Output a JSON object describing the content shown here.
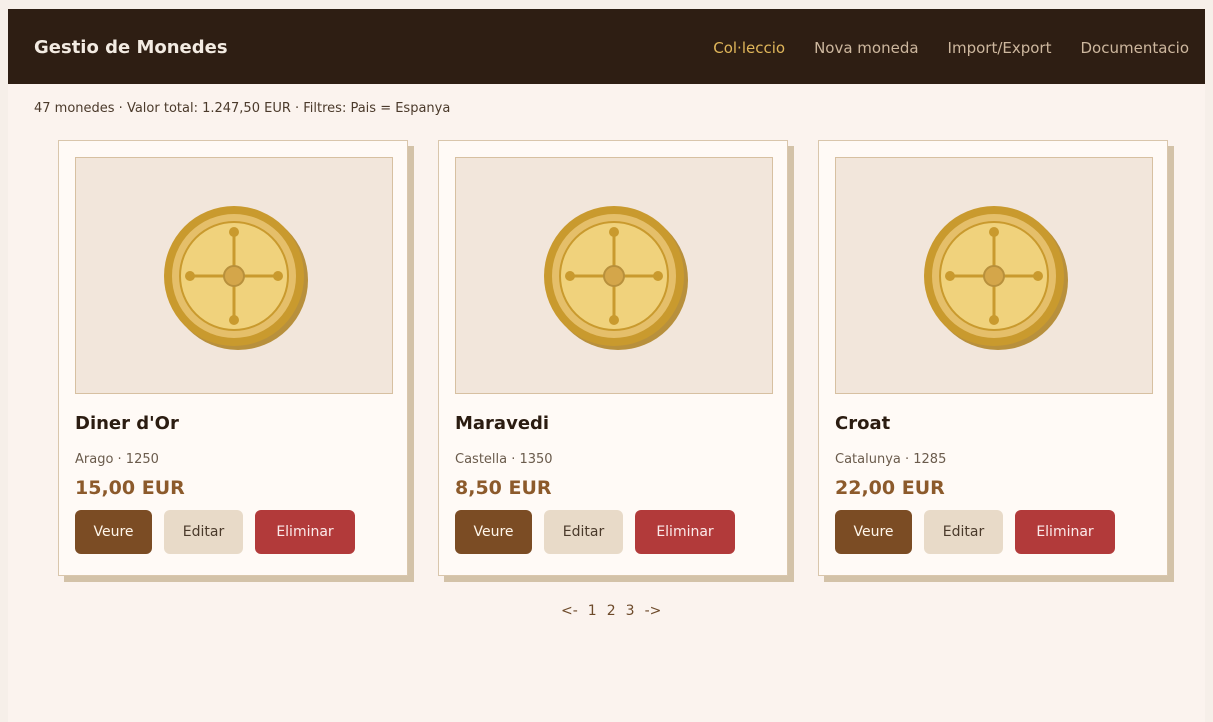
{
  "app": {
    "title": "Gestio de Monedes",
    "nav": [
      {
        "label": "Col·leccio",
        "active": true
      },
      {
        "label": "Nova moneda",
        "active": false
      },
      {
        "label": "Import/Export",
        "active": false
      },
      {
        "label": "Documentacio",
        "active": false
      }
    ]
  },
  "summary": "47 monedes · Valor total: 1.247,50 EUR  ·  Filtres: Pais = Espanya",
  "coins": [
    {
      "name": "Diner d'Or",
      "meta": "Arago · 1250",
      "price": "15,00 EUR",
      "icon": "coin-image"
    },
    {
      "name": "Maravedi",
      "meta": "Castella · 1350",
      "price": "8,50 EUR",
      "icon": "coin-image"
    },
    {
      "name": "Croat",
      "meta": "Catalunya · 1285",
      "price": "22,00 EUR",
      "icon": "coin-image"
    }
  ],
  "actions": {
    "view": "Veure",
    "edit": "Editar",
    "delete": "Eliminar"
  },
  "pager": {
    "prev": "<-",
    "pages": [
      "1",
      "2",
      "3"
    ],
    "next": "->"
  },
  "colors": {
    "topbar": "#2e1e13",
    "accent": "#e0b65a",
    "view_button": "#7b4c24",
    "delete_button": "#b23a3a"
  }
}
